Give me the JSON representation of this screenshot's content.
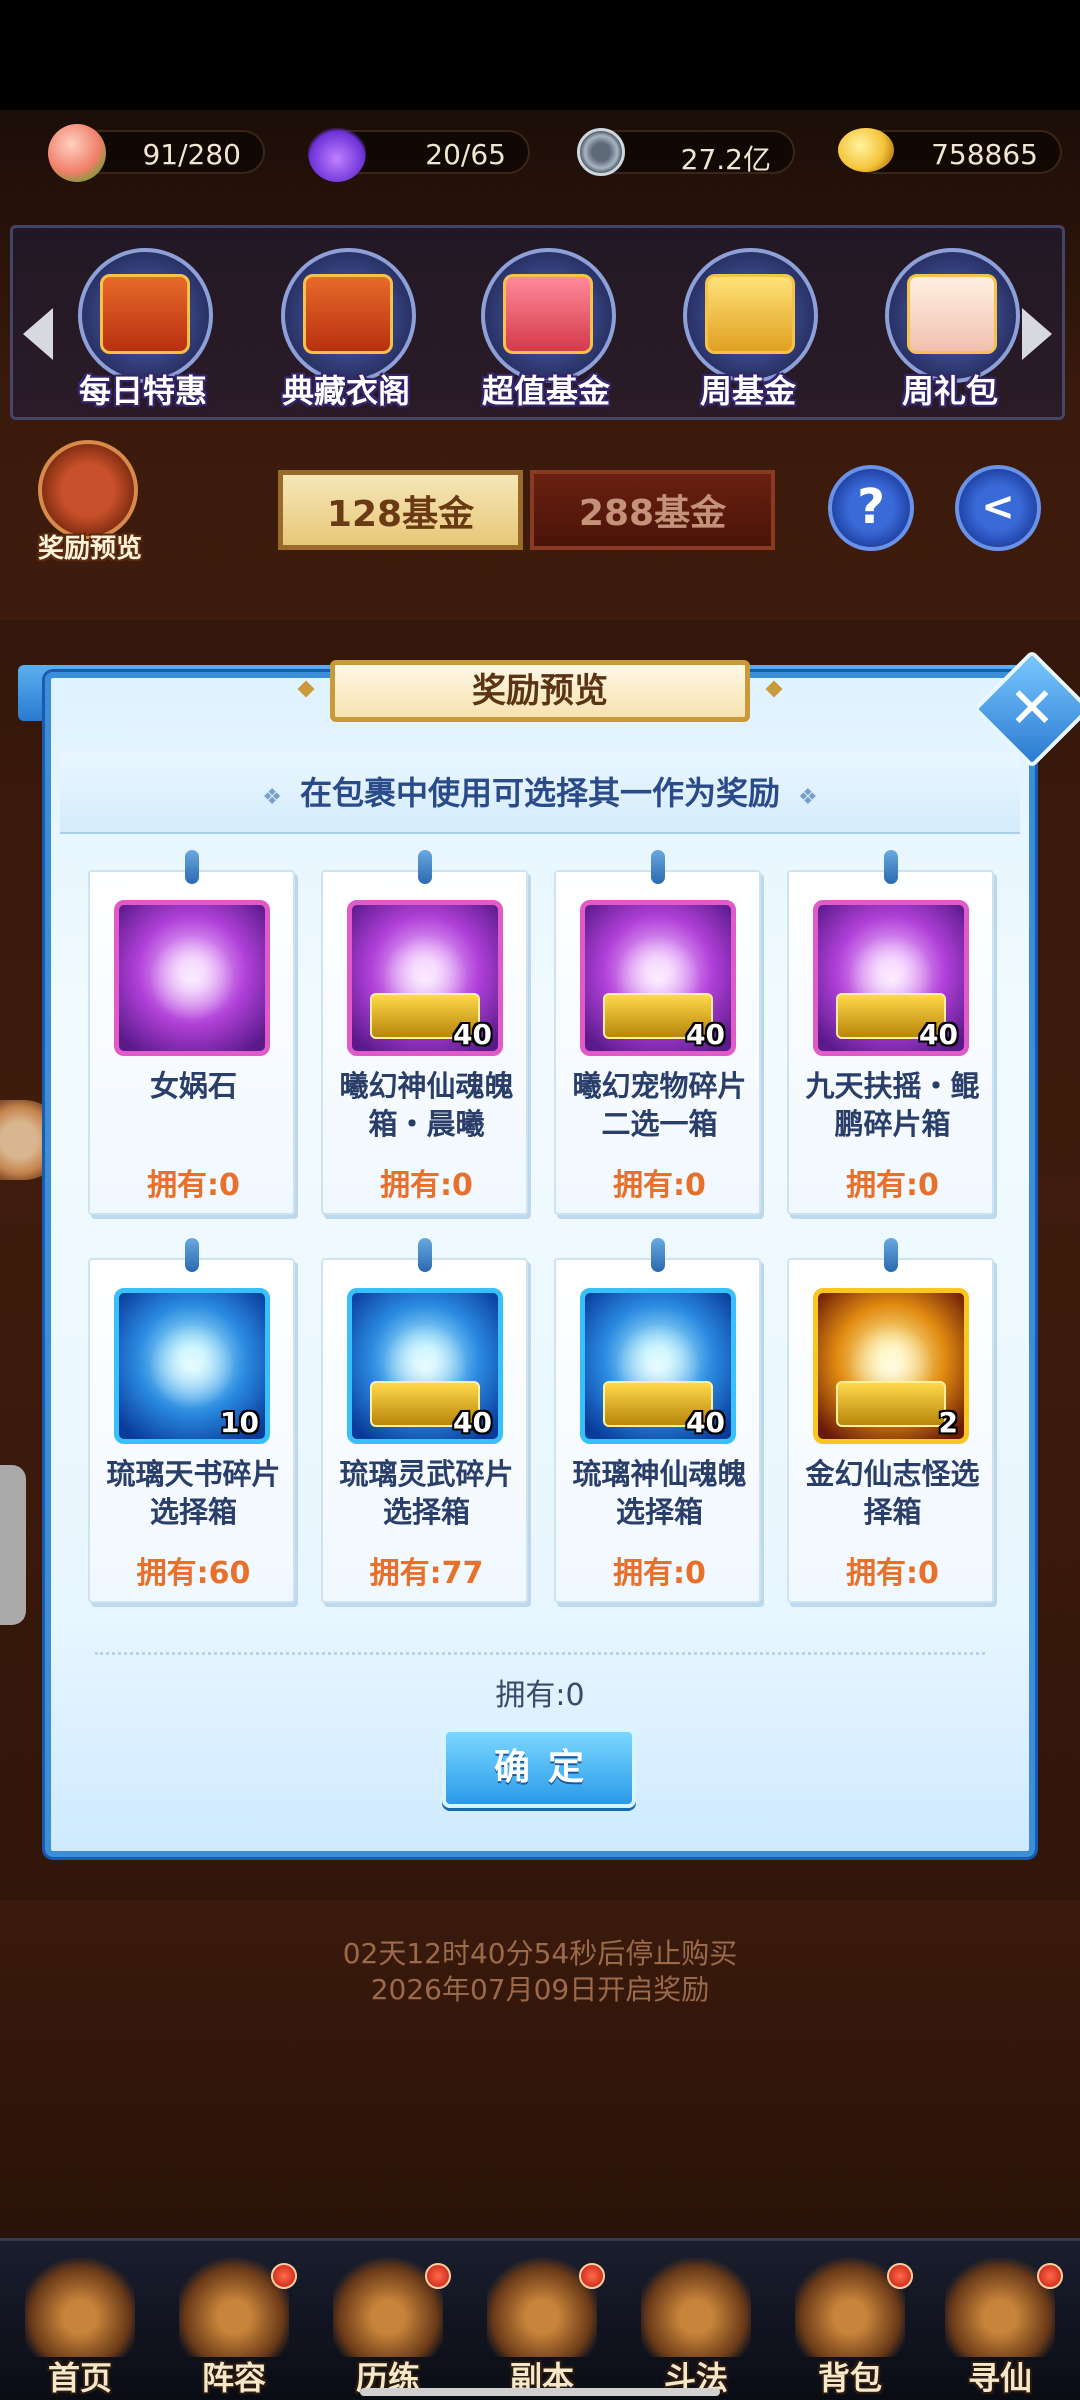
{
  "resources": [
    {
      "value": "91/280",
      "icon": "peach-icon"
    },
    {
      "value": "20/65",
      "icon": "spirit-flame-icon"
    },
    {
      "value": "27.2亿",
      "icon": "copper-coin-icon"
    },
    {
      "value": "758865",
      "icon": "gold-ingot-icon"
    }
  ],
  "nav": {
    "items": [
      {
        "label": "每日特惠"
      },
      {
        "label": "典藏衣阁"
      },
      {
        "label": "超值基金"
      },
      {
        "label": "周基金"
      },
      {
        "label": "周礼包"
      }
    ]
  },
  "funds": {
    "preview_label": "奖励预览",
    "tab_128": "128基金",
    "tab_288": "288基金",
    "help_symbol": "?",
    "back_icon": "back-arrow-icon"
  },
  "dialog": {
    "title": "奖励预览",
    "close_symbol": "✕",
    "hint": "在包裹中使用可选择其一作为奖励",
    "hint_deco": "❖",
    "items": [
      {
        "name": "女娲石",
        "owned": "拥有:0",
        "count": "",
        "icon": "nuwa-stone-icon"
      },
      {
        "name": "曦幻神仙魂魄箱・晨曦",
        "owned": "拥有:0",
        "count": "40",
        "icon": "immortal-soul-chest-icon"
      },
      {
        "name": "曦幻宠物碎片二选一箱",
        "owned": "拥有:0",
        "count": "40",
        "icon": "pet-fragment-chest-icon"
      },
      {
        "name": "九天扶摇・鲲鹏碎片箱",
        "owned": "拥有:0",
        "count": "40",
        "icon": "kunpeng-fragment-chest-icon"
      },
      {
        "name": "琉璃天书碎片选择箱",
        "owned": "拥有:60",
        "count": "10",
        "icon": "heaven-book-chest-icon"
      },
      {
        "name": "琉璃灵武碎片选择箱",
        "owned": "拥有:77",
        "count": "40",
        "icon": "spirit-weapon-chest-icon"
      },
      {
        "name": "琉璃神仙魂魄选择箱",
        "owned": "拥有:0",
        "count": "40",
        "icon": "glaze-soul-chest-icon"
      },
      {
        "name": "金幻仙志怪选择箱",
        "owned": "拥有:0",
        "count": "2",
        "icon": "gold-treasure-chest-icon"
      }
    ],
    "owned_total": "拥有:0",
    "confirm_label": "确定"
  },
  "footer": {
    "countdown": "02天12时40分54秒后停止购买",
    "open_date": "2026年07月09日开启奖励"
  },
  "bottom_nav": [
    {
      "label": "首页",
      "badge": false
    },
    {
      "label": "阵容",
      "badge": true
    },
    {
      "label": "历练",
      "badge": true
    },
    {
      "label": "副本",
      "badge": true
    },
    {
      "label": "斗法",
      "badge": false
    },
    {
      "label": "背包",
      "badge": true
    },
    {
      "label": "寻仙",
      "badge": true
    }
  ]
}
